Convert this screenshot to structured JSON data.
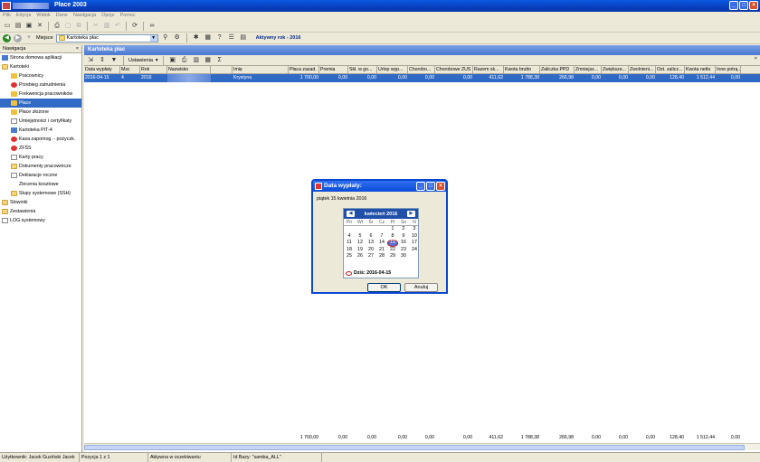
{
  "window": {
    "title": "Płace 2003"
  },
  "menu": [
    "Plik",
    "Edycja",
    "Widok",
    "Dane",
    "Nawigacja",
    "Opcje",
    "Pomoc"
  ],
  "toolbar2": {
    "address_label": "Miejsce",
    "address_value": "Kartoteka płac",
    "active_year": "Aktywny rok - 2016"
  },
  "nav": {
    "title": "Nawigacja",
    "items": [
      {
        "label": "Strona domowa aplikacji",
        "level": 0
      },
      {
        "label": "Kartoteki",
        "level": 0
      },
      {
        "label": "Pracownicy",
        "level": 1
      },
      {
        "label": "Przebieg zatrudnienia",
        "level": 1
      },
      {
        "label": "Frekwencja pracowników",
        "level": 1
      },
      {
        "label": "Płace",
        "level": 1
      },
      {
        "label": "Płace złożone",
        "level": 1
      },
      {
        "label": "Umiejętności i certyfikaty",
        "level": 1
      },
      {
        "label": "Kartoteka PIT-4",
        "level": 1
      },
      {
        "label": "Kasa zapomog. - pożyczk.",
        "level": 1
      },
      {
        "label": "ZFŚS",
        "level": 1
      },
      {
        "label": "Karty pracy",
        "level": 1
      },
      {
        "label": "Dokumenty pracownicze",
        "level": 1
      },
      {
        "label": "Deklaracje roczne",
        "level": 1
      },
      {
        "label": "Zlecenia kosztowe",
        "level": 1
      },
      {
        "label": "Słupy systemowe (SSH)",
        "level": 1
      },
      {
        "label": "Słowniki",
        "level": 0
      },
      {
        "label": "Zestawienia",
        "level": 0
      },
      {
        "label": "LOG systemowy",
        "level": 0
      }
    ]
  },
  "main": {
    "title": "Kartoteka płac",
    "settings_label": "Ustawienia",
    "columns": [
      "Data wypłaty",
      "Msc",
      "Rok",
      "Nazwisko",
      "",
      "Imię",
      "Płaca zasad.",
      "Premia",
      "Skł. w go...",
      "Urlop wyp...",
      "Chorobo...",
      "Chorobowe ZUS",
      "Razem sk...",
      "Kwota brutto",
      "Zaliczka PPD",
      "Zmniejsz...",
      "Zwiększe...",
      "Zwolnieni...",
      "Ost. zalicz...",
      "Kwota netto",
      "Inne potrą..."
    ],
    "row": [
      "2016-04-15",
      "4",
      "2016",
      "",
      "",
      "Krystyna",
      "1 700,00",
      "0,00",
      "0,00",
      "0,00",
      "0,00",
      "0,00",
      "411,62",
      "1 788,38",
      "266,98",
      "0,00",
      "0,00",
      "0,00",
      "128,40",
      "1 512,44",
      "0,00"
    ],
    "totals": [
      "",
      "",
      "",
      "",
      "",
      "",
      "1 700,00",
      "0,00",
      "0,00",
      "0,00",
      "0,00",
      "0,00",
      "411,62",
      "1 788,38",
      "266,98",
      "0,00",
      "0,00",
      "0,00",
      "128,40",
      "1 512,44",
      "0,00"
    ]
  },
  "status": [
    "Użytkownik: Jacek Guziński Jacek",
    "Pozycja 1 z 1",
    "Aktywna w oczekiwaniu",
    "Id Bazy: \"samba_ALL\""
  ],
  "dialog": {
    "title": "Data wypłaty:",
    "date_text": "piątek 15 kwietnia 2016",
    "month": "kwiecień 2016",
    "weekdays": [
      "Pn",
      "Wt",
      "Śr",
      "Cz",
      "Pt",
      "So",
      "N"
    ],
    "days": [
      "",
      "",
      "",
      "",
      "1",
      "2",
      "3",
      "4",
      "5",
      "6",
      "7",
      "8",
      "9",
      "10",
      "11",
      "12",
      "13",
      "14",
      "15",
      "16",
      "17",
      "18",
      "19",
      "20",
      "21",
      "22",
      "23",
      "24",
      "25",
      "26",
      "27",
      "28",
      "29",
      "30",
      ""
    ],
    "today_label": "Dziś: 2016-04-15",
    "ok_label": "OK",
    "cancel_label": "Anuluj"
  }
}
